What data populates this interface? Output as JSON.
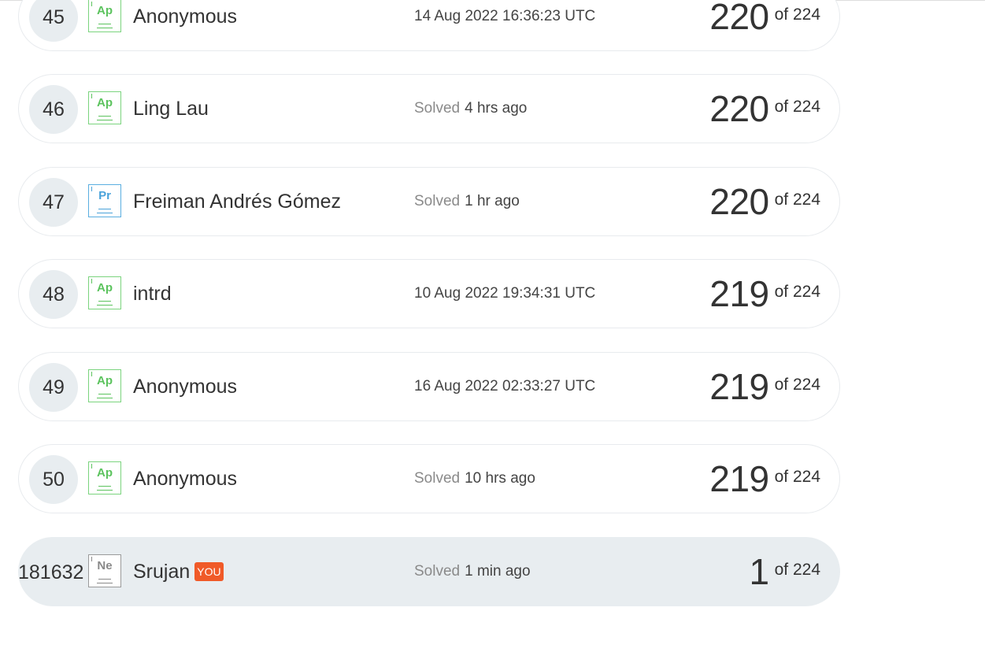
{
  "leaderboard": {
    "rows": [
      {
        "rank": "45",
        "badge": "Ap",
        "name": "Anonymous",
        "solved_label": "",
        "time": "14 Aug 2022 16:36:23 UTC",
        "score": "220",
        "total": "of 224"
      },
      {
        "rank": "46",
        "badge": "Ap",
        "name": "Ling Lau",
        "solved_label": "Solved",
        "time": "4 hrs ago",
        "score": "220",
        "total": "of 224"
      },
      {
        "rank": "47",
        "badge": "Pr",
        "name": "Freiman Andrés Gómez",
        "solved_label": "Solved",
        "time": "1 hr ago",
        "score": "220",
        "total": "of 224"
      },
      {
        "rank": "48",
        "badge": "Ap",
        "name": "intrd",
        "solved_label": "",
        "time": "10 Aug 2022 19:34:31 UTC",
        "score": "219",
        "total": "of 224"
      },
      {
        "rank": "49",
        "badge": "Ap",
        "name": "Anonymous",
        "solved_label": "",
        "time": "16 Aug 2022 02:33:27 UTC",
        "score": "219",
        "total": "of 224"
      },
      {
        "rank": "50",
        "badge": "Ap",
        "name": "Anonymous",
        "solved_label": "Solved",
        "time": "10 hrs ago",
        "score": "219",
        "total": "of 224"
      }
    ],
    "current_user": {
      "rank": "181632",
      "badge": "Ne",
      "name": "Srujan",
      "you_label": "YOU",
      "solved_label": "Solved",
      "time": "1 min ago",
      "score": "1",
      "total": "of 224"
    }
  },
  "colors": {
    "row_border": "#e8ebee",
    "rank_circle_bg": "#e8edf0",
    "current_user_bg": "#e8edf0",
    "badge_ap": "#7bd47e",
    "badge_pr": "#5aaee0",
    "badge_ne": "#9a9a9a",
    "you_tag": "#f05a28"
  },
  "icons": {
    "badge_ap": "ap-level-badge-icon",
    "badge_pr": "pr-level-badge-icon",
    "badge_ne": "ne-level-badge-icon"
  }
}
